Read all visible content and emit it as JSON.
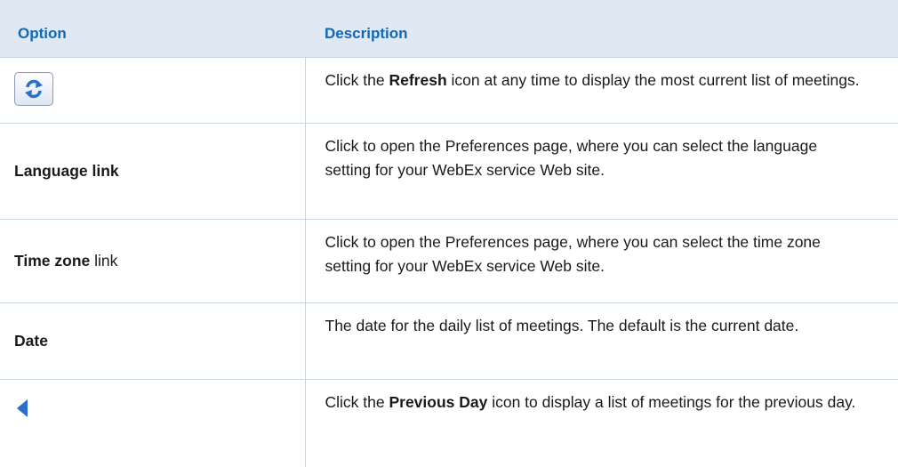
{
  "header": {
    "option": "Option",
    "description": "Description"
  },
  "rows": [
    {
      "option_icon": "refresh-icon",
      "desc_pre": "Click the ",
      "desc_bold": "Refresh",
      "desc_post": " icon at any time to display the most current list of meetings."
    },
    {
      "option_bold": "Language link",
      "desc": "Click to open the Preferences page, where you can select the language setting for your WebEx service Web site."
    },
    {
      "option_bold": "Time zone",
      "option_rest": " link",
      "desc": "Click to open the Preferences page, where you can select the time zone setting for your WebEx service Web site."
    },
    {
      "option_bold": "Date",
      "desc": "The date for the daily list of meetings. The default is the current date."
    },
    {
      "option_icon": "previous-day-arrow-icon",
      "desc_pre": "Click the ",
      "desc_bold": "Previous Day",
      "desc_post": " icon to display a list of meetings for the previous day."
    }
  ],
  "colors": {
    "header_bg": "#dfe8f3",
    "header_text": "#1268b3",
    "rule": "#c9d4e3",
    "icon_blue": "#2a6fc9"
  }
}
